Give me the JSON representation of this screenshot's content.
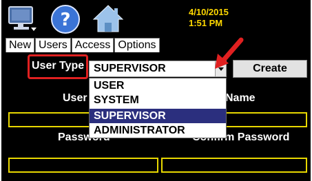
{
  "header": {
    "date": "4/10/2015",
    "time": "1:51 PM",
    "icons": [
      "monitor-icon",
      "help-icon",
      "home-icon"
    ]
  },
  "tabs": [
    "New",
    "Users",
    "Access",
    "Options"
  ],
  "form": {
    "user_type_label": "User Type",
    "user_type_value": "SUPERVISOR",
    "create_label": "Create",
    "user_label": "User",
    "name_label": "Name",
    "password_label": "Password",
    "confirm_password_label": "Confirm Password",
    "dropdown_options": [
      "USER",
      "SYSTEM",
      "SUPERVISOR",
      "ADMINISTRATOR"
    ],
    "selected_option": "SUPERVISOR"
  },
  "colors": {
    "accent_yellow": "#ffd800",
    "field_border": "#e8d800",
    "highlight_red": "#e02020",
    "selected_bg": "#2b2f7e"
  }
}
